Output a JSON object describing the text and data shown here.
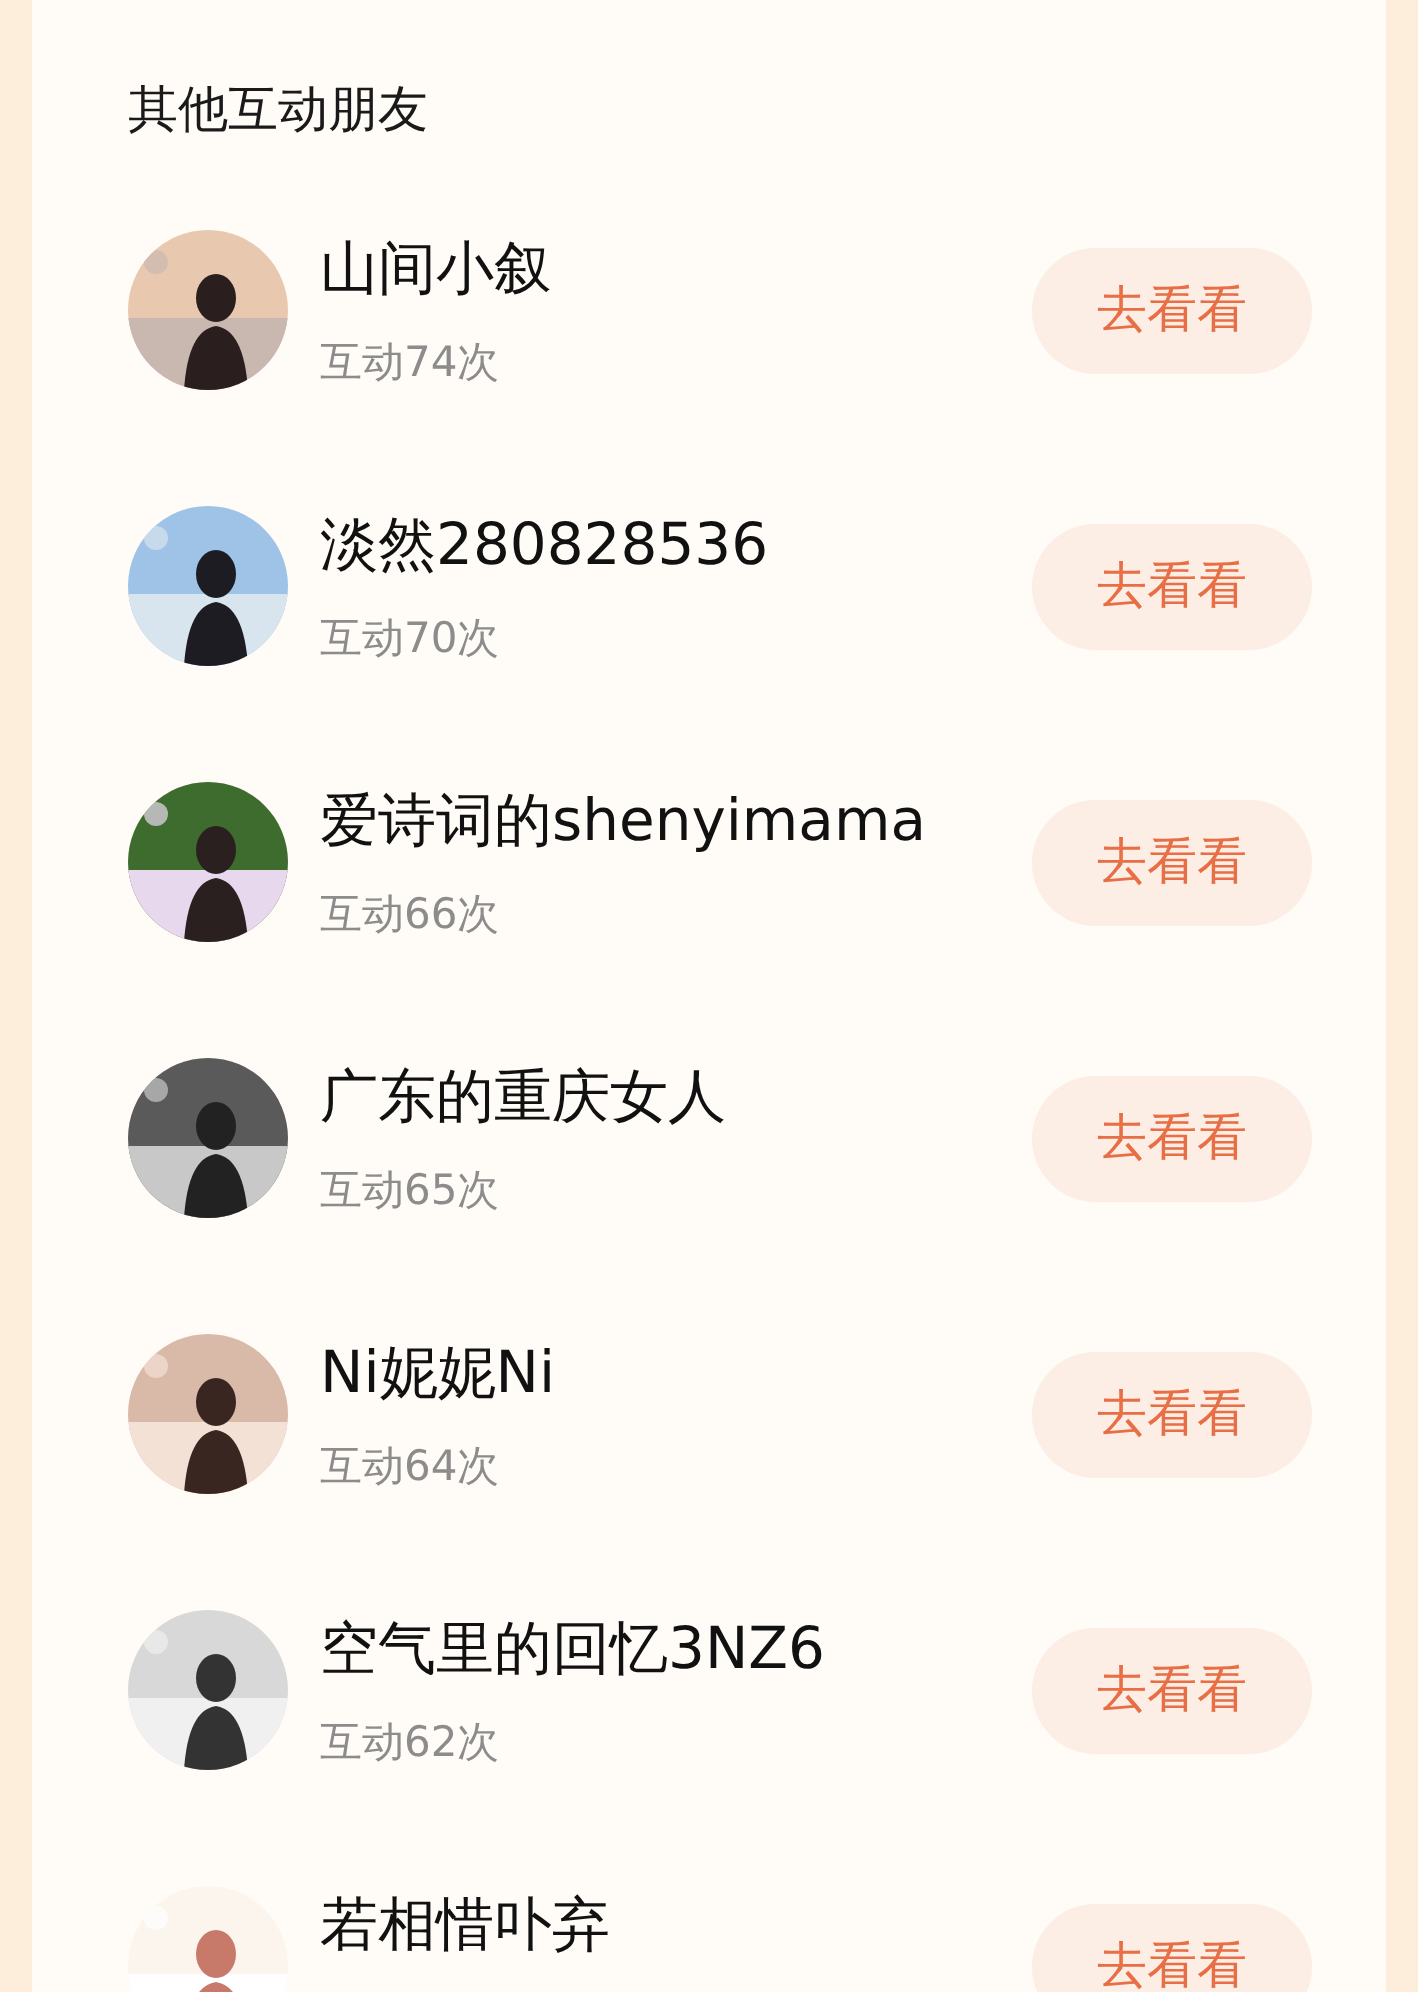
{
  "section_title": "其他互动朋友",
  "friends": [
    {
      "name": "山间小叙",
      "count": "互动74次",
      "button": "去看看"
    },
    {
      "name": "淡然280828536",
      "count": "互动70次",
      "button": "去看看"
    },
    {
      "name": "爱诗词的shenyimama",
      "count": "互动66次",
      "button": "去看看"
    },
    {
      "name": "广东的重庆女人",
      "count": "互动65次",
      "button": "去看看"
    },
    {
      "name": "Ni妮妮Ni",
      "count": "互动64次",
      "button": "去看看"
    },
    {
      "name": "空气里的回忆3NZ6",
      "count": "互动62次",
      "button": "去看看"
    },
    {
      "name": "若相惜卟弃",
      "button": "去看看"
    }
  ]
}
